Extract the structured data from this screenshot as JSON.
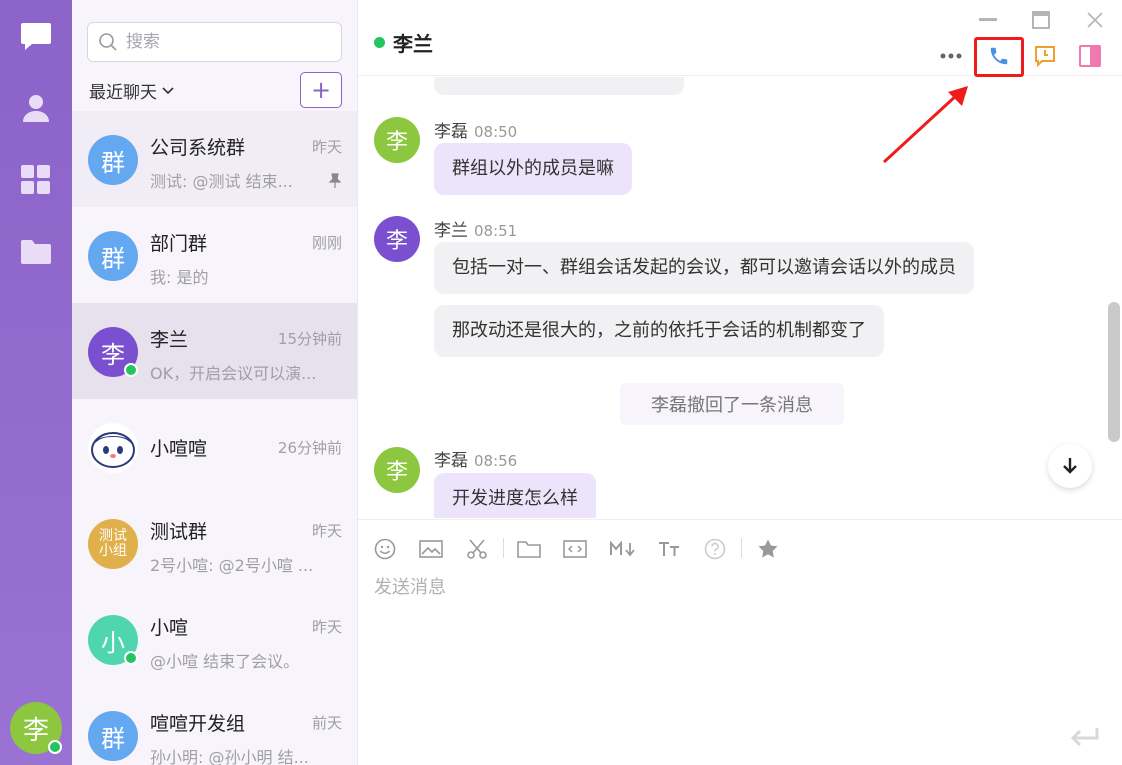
{
  "rail": {
    "user_avatar_text": "李",
    "items": [
      "chat-icon",
      "contacts-icon",
      "apps-icon",
      "folder-icon"
    ]
  },
  "list": {
    "search_placeholder": "搜索",
    "recent_label": "最近聊天",
    "add_label": "+",
    "conversations": [
      {
        "name": "公司系统群",
        "time": "昨天",
        "preview": "测试: @测试 结束...",
        "avatar_text": "群",
        "avatar_color": "#64a8f0",
        "pinned": true
      },
      {
        "name": "部门群",
        "time": "刚刚",
        "preview": "我: 是的",
        "avatar_text": "群",
        "avatar_color": "#64a8f0"
      },
      {
        "name": "李兰",
        "time": "15分钟前",
        "preview": "OK，开启会议可以演...",
        "avatar_text": "李",
        "avatar_color": "#7a4fd0",
        "active": true,
        "online": true
      },
      {
        "name": "小喧喧",
        "time": "26分钟前",
        "preview": "",
        "avatar_text": "",
        "avatar_color": "#ffffff"
      },
      {
        "name": "测试群",
        "time": "昨天",
        "preview": "2号小喧: @2号小喧 ...",
        "avatar_text_line1": "测试",
        "avatar_text_line2": "小组",
        "avatar_color": "#e0b04a"
      },
      {
        "name": "小喧",
        "time": "昨天",
        "preview": "@小喧 结束了会议。",
        "avatar_text": "小",
        "avatar_color": "#4fd6b0",
        "online": true
      },
      {
        "name": "喧喧开发组",
        "time": "前天",
        "preview": "孙小明: @孙小明 结...",
        "avatar_text": "群",
        "avatar_color": "#64a8f0"
      }
    ]
  },
  "chat": {
    "title": "李兰",
    "header_icons": [
      "more-icon",
      "phone-icon",
      "clock-icon",
      "sidebar-toggle-icon"
    ],
    "messages": [
      {
        "sender": "李磊",
        "time": "08:50",
        "avatar_text": "李",
        "avatar_color": "#8dc63f",
        "texts": [
          "群组以外的成员是嘛"
        ],
        "bubble": "purple"
      },
      {
        "sender": "李兰",
        "time": "08:51",
        "avatar_text": "李",
        "avatar_color": "#7a4fd0",
        "texts": [
          "包括一对一、群组会话发起的会议，都可以邀请会话以外的成员",
          "那改动还是很大的，之前的依托于会话的机制都变了"
        ],
        "bubble": "gray"
      },
      {
        "sender": "李磊",
        "time": "08:56",
        "avatar_text": "李",
        "avatar_color": "#8dc63f",
        "texts": [
          "开发进度怎么样"
        ],
        "bubble": "purple"
      }
    ],
    "system_notice": "李磊撤回了一条消息",
    "composer_placeholder": "发送消息",
    "toolbar_icons": [
      "emoji-icon",
      "image-icon",
      "scissors-icon",
      "folder-icon",
      "code-icon",
      "markdown-icon",
      "font-size-icon",
      "help-icon",
      "star-icon"
    ]
  },
  "colors": {
    "brand": "#8b63c9",
    "online": "#22c55e",
    "highlight": "#f01c1c"
  }
}
